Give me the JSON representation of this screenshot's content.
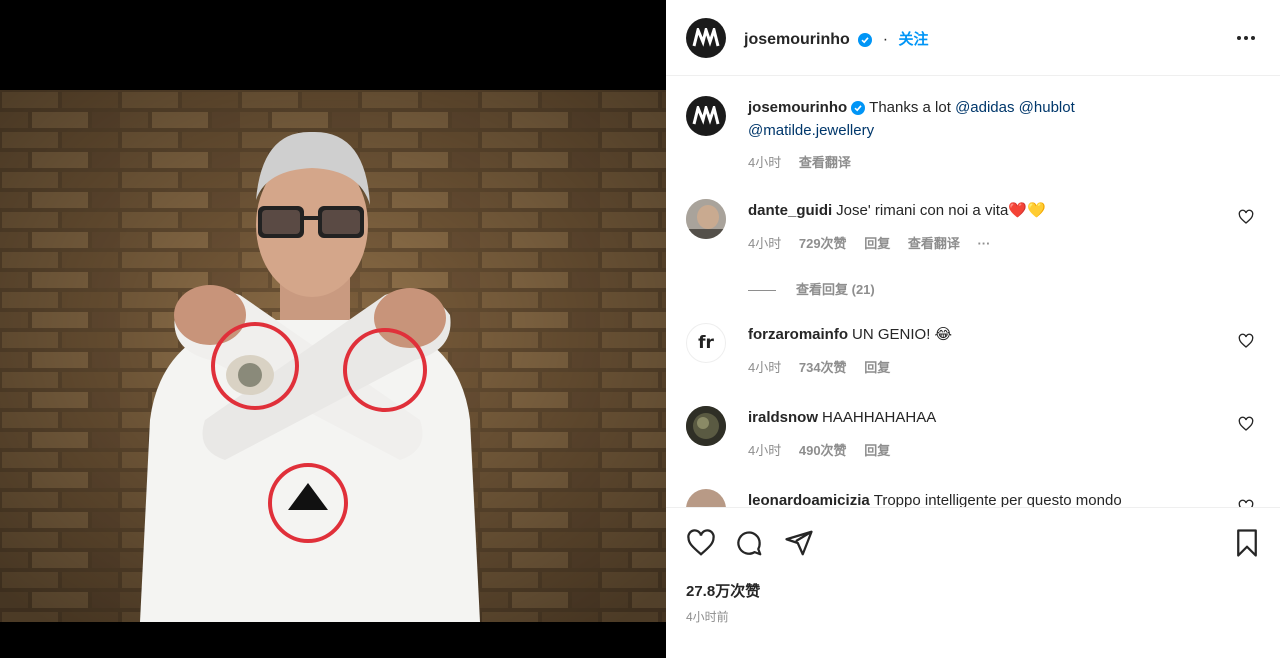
{
  "post": {
    "author": "josemourinho",
    "follow_label": "关注",
    "caption_author": "josemourinho",
    "caption_text": "Thanks a lot",
    "caption_mentions": [
      "@adidas",
      "@hublot",
      "@matilde.jewellery"
    ],
    "caption_time": "4小时",
    "caption_translate": "查看翻译",
    "likes": "27.8万次赞",
    "posted": "4小时前"
  },
  "comments": [
    {
      "user": "dante_guidi",
      "text": "Jose' rimani con noi a vita",
      "emoji": "❤️💛",
      "time": "4小时",
      "likes": "729次赞",
      "reply": "回复",
      "translate": "查看翻译",
      "more": "···",
      "view_replies": "查看回复 (21)"
    },
    {
      "user": "forzaromainfo",
      "text": "UN GENIO!",
      "emoji": "😂",
      "time": "4小时",
      "likes": "734次赞",
      "reply": "回复",
      "avatar_text": "fr"
    },
    {
      "user": "iraldsnow",
      "text": "HAAHHAHAHAA",
      "time": "4小时",
      "likes": "490次赞",
      "reply": "回复"
    },
    {
      "user": "leonardoamicizia",
      "text": "Troppo intelligente per questo mondo"
    }
  ],
  "colors": {
    "accent": "#0095f6",
    "verified": "#0095f6",
    "circle": "#e0303a",
    "brick": "#7a6040"
  }
}
